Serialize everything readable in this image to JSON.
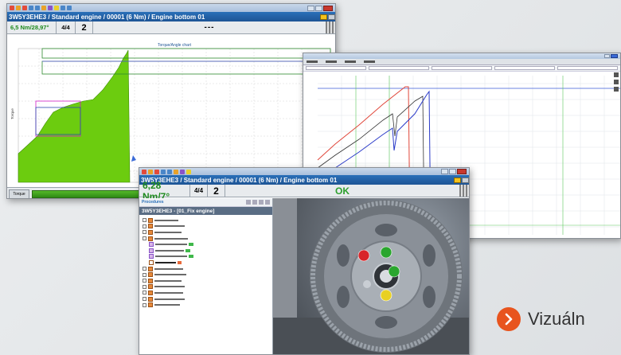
{
  "win1": {
    "path": "3W5Y3EHE3 / Standard engine / 00001 (6 Nm) / Engine bottom 01",
    "torque": "6,5 Nm/28,97°",
    "count": "4/4",
    "program": "2",
    "result": "---",
    "chart_title": "Torque/Angle chart",
    "ylabel": "Torque",
    "bottom_button": "Torque"
  },
  "win3": {
    "path": "3W5Y3EHE3 / Standard engine / 00001 (6 Nm) / Engine bottom 01",
    "torque": "6,28 Nm/7°",
    "count": "4/4",
    "program": "2",
    "result": "OK",
    "tree_header": "Procedures",
    "tree_title": "3W5Y3EHE3 - [01_Fix engine]"
  },
  "caption": "Vizuáln",
  "colors": {
    "green_fill": "#6ccc0f",
    "path_blue": "#1d5495",
    "ok_green": "#2ea02e",
    "accent_orange": "#e8541e"
  }
}
